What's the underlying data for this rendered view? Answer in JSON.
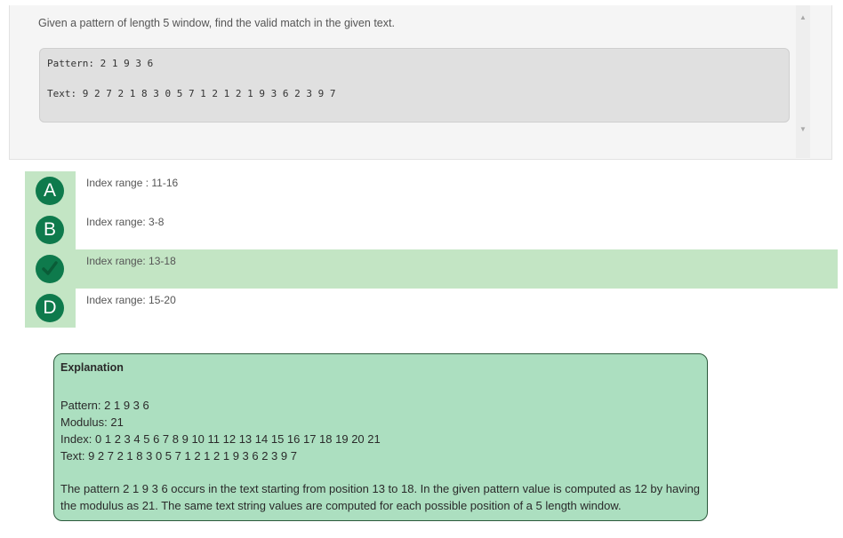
{
  "question": {
    "text": "Given a pattern of length 5 window, find the valid match in the given text.",
    "code_lines": [
      "Pattern: 2 1 9 3 6",
      "Text: 9 2 7 2 1 8 3 0 5 7 1 2 1 2 1 9 3 6 2 3 9 7"
    ]
  },
  "options": [
    {
      "marker": "A",
      "label": "Index range : 11-16",
      "state": "unselected"
    },
    {
      "marker": "B",
      "label": "Index range: 3-8",
      "state": "unselected"
    },
    {
      "marker": "check-icon",
      "label": "Index range: 13-18",
      "state": "correct"
    },
    {
      "marker": "D",
      "label": "Index range: 15-20",
      "state": "unselected"
    }
  ],
  "explanation": {
    "title": "Explanation",
    "lines": [
      "Pattern: 2 1 9 3 6",
      "Modulus: 21",
      "Index: 0 1 2 3 4 5 6 7 8 9 10 11 12 13 14 15 16 17 18 19 20 21",
      "Text: 9 2 7 2 1 8 3 0 5 7 1 2 1 2 1 9 3 6 2 3 9 7"
    ],
    "paragraph": "The pattern 2 1 9 3 6 occurs in the text starting from position 13 to 18. In the given pattern value is computed as 12 by having the modulus as 21. The same text string values are computed for each possible position of a 5 length window."
  },
  "colors": {
    "accent_green": "#0e7a4c",
    "correct_highlight": "#c3e5c4",
    "explanation_bg": "#acdfc0"
  }
}
